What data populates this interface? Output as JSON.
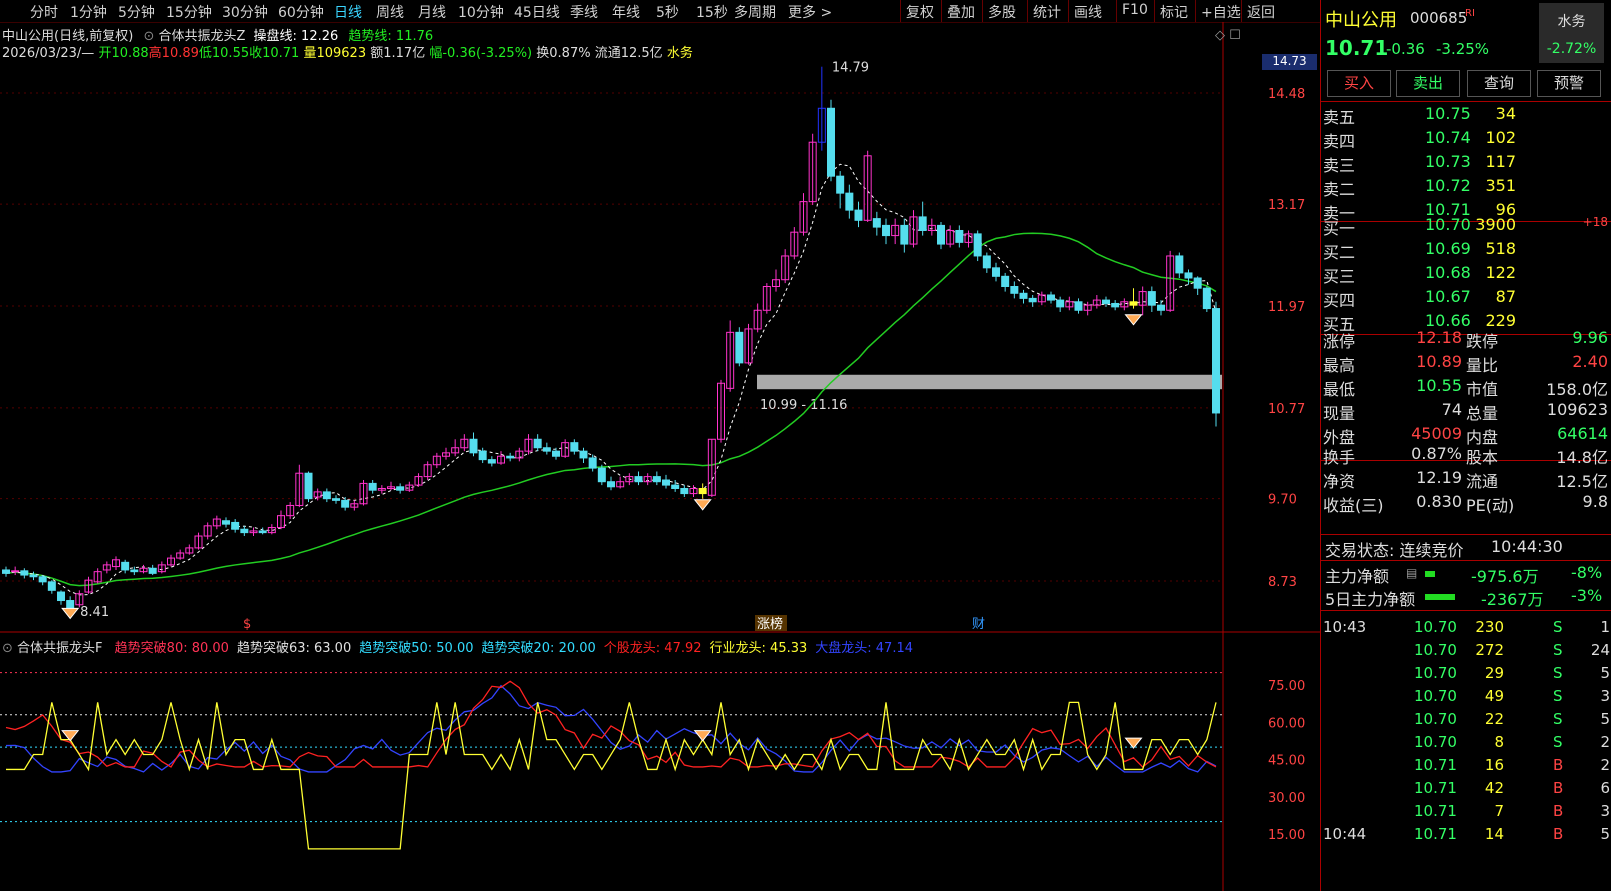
{
  "toolbar": {
    "periods": [
      "分时",
      "1分钟",
      "5分钟",
      "15分钟",
      "30分钟",
      "60分钟",
      "日线",
      "周线",
      "月线",
      "10分钟",
      "45日线",
      "季线",
      "年线",
      "5秒",
      "15秒",
      "多周期",
      "更多 >"
    ],
    "active_period": "日线",
    "right_buttons": [
      "复权",
      "叠加",
      "多股",
      "统计",
      "画线",
      "F10",
      "标记",
      "+自选",
      "返回"
    ]
  },
  "header": {
    "stock_name": "中山公用",
    "mode": "(日线,前复权)",
    "indicator_name": "合体共振龙头Z",
    "caopan_label": "操盘线: 12.26",
    "qushi_label": "趋势线: 11.76",
    "date": "2026/03/23/—",
    "open": "开10.88",
    "high": "高10.89",
    "low": "低10.55",
    "close": "收10.71",
    "volume": "量109623",
    "amount": "额1.17亿",
    "range": "幅-0.36(-3.25%)",
    "turnover": "换0.87%",
    "float": "流通12.5亿",
    "sector": "水务"
  },
  "price_axis": {
    "current": "14.73",
    "ticks": [
      "14.48",
      "13.17",
      "11.97",
      "10.77",
      "9.70",
      "8.73"
    ]
  },
  "annotations": {
    "high_label": "14.79",
    "low_label": "8.41",
    "zone_label": "10.99 - 11.16",
    "event_1": "$",
    "event_2": "涨榜",
    "event_3": "财"
  },
  "sub_indicator": {
    "name": "合体共振龙头F",
    "items": [
      {
        "text": "趋势突破80: 80.00",
        "color": "#ff3355"
      },
      {
        "text": "趋势突破63: 63.00",
        "color": "#e0e0e0"
      },
      {
        "text": "趋势突破50: 50.00",
        "color": "#33ddff"
      },
      {
        "text": "趋势突破20: 20.00",
        "color": "#33ddff"
      },
      {
        "text": "个股龙头: 47.92",
        "color": "#ff2222"
      },
      {
        "text": "行业龙头: 45.33",
        "color": "#ffff33"
      },
      {
        "text": "大盘龙头: 47.14",
        "color": "#3344ff"
      }
    ],
    "ticks": [
      "75.00",
      "60.00",
      "45.00",
      "30.00",
      "15.00"
    ]
  },
  "chart_data": {
    "type": "candlestick",
    "series": [
      {
        "name": "操盘线",
        "values": []
      },
      {
        "name": "趋势线",
        "values": []
      }
    ],
    "candles": [
      [
        8.86,
        8.82,
        8.9,
        8.78
      ],
      [
        8.84,
        8.85,
        8.9,
        8.8
      ],
      [
        8.85,
        8.8,
        8.88,
        8.76
      ],
      [
        8.8,
        8.78,
        8.84,
        8.74
      ],
      [
        8.78,
        8.72,
        8.8,
        8.68
      ],
      [
        8.72,
        8.62,
        8.74,
        8.58
      ],
      [
        8.6,
        8.5,
        8.62,
        8.45
      ],
      [
        8.5,
        8.41,
        8.55,
        8.41
      ],
      [
        8.45,
        8.58,
        8.62,
        8.42
      ],
      [
        8.6,
        8.74,
        8.78,
        8.58
      ],
      [
        8.72,
        8.84,
        8.88,
        8.7
      ],
      [
        8.86,
        8.92,
        8.96,
        8.82
      ],
      [
        8.9,
        8.98,
        9.02,
        8.86
      ],
      [
        8.95,
        8.86,
        8.98,
        8.82
      ],
      [
        8.86,
        8.84,
        8.9,
        8.8
      ],
      [
        8.84,
        8.88,
        8.92,
        8.82
      ],
      [
        8.88,
        8.82,
        8.92,
        8.8
      ],
      [
        8.84,
        8.92,
        8.96,
        8.82
      ],
      [
        8.92,
        9.0,
        9.04,
        8.9
      ],
      [
        9.0,
        9.06,
        9.1,
        8.98
      ],
      [
        9.06,
        9.12,
        9.16,
        9.04
      ],
      [
        9.12,
        9.26,
        9.3,
        9.1
      ],
      [
        9.26,
        9.38,
        9.42,
        9.22
      ],
      [
        9.38,
        9.46,
        9.5,
        9.34
      ],
      [
        9.44,
        9.4,
        9.48,
        9.36
      ],
      [
        9.42,
        9.34,
        9.46,
        9.3
      ],
      [
        9.34,
        9.3,
        9.38,
        9.26
      ],
      [
        9.3,
        9.32,
        9.36,
        9.26
      ],
      [
        9.32,
        9.3,
        9.36,
        9.28
      ],
      [
        9.3,
        9.36,
        9.4,
        9.28
      ],
      [
        9.36,
        9.5,
        9.56,
        9.34
      ],
      [
        9.5,
        9.62,
        9.66,
        9.46
      ],
      [
        9.62,
        10.0,
        10.1,
        9.6
      ],
      [
        10.0,
        9.7,
        10.02,
        9.66
      ],
      [
        9.72,
        9.78,
        9.82,
        9.68
      ],
      [
        9.78,
        9.7,
        9.82,
        9.66
      ],
      [
        9.7,
        9.68,
        9.74,
        9.64
      ],
      [
        9.68,
        9.6,
        9.72,
        9.56
      ],
      [
        9.6,
        9.64,
        9.68,
        9.56
      ],
      [
        9.64,
        9.88,
        9.92,
        9.62
      ],
      [
        9.88,
        9.8,
        9.92,
        9.76
      ],
      [
        9.8,
        9.82,
        9.86,
        9.76
      ],
      [
        9.82,
        9.84,
        9.9,
        9.8
      ],
      [
        9.84,
        9.8,
        9.88,
        9.76
      ],
      [
        9.8,
        9.86,
        9.9,
        9.78
      ],
      [
        9.86,
        9.96,
        10.0,
        9.84
      ],
      [
        9.96,
        10.1,
        10.14,
        9.92
      ],
      [
        10.1,
        10.2,
        10.24,
        10.06
      ],
      [
        10.2,
        10.24,
        10.3,
        10.16
      ],
      [
        10.24,
        10.3,
        10.4,
        10.2
      ],
      [
        10.3,
        10.4,
        10.46,
        10.26
      ],
      [
        10.4,
        10.24,
        10.48,
        10.2
      ],
      [
        10.26,
        10.16,
        10.3,
        10.12
      ],
      [
        10.16,
        10.12,
        10.2,
        10.08
      ],
      [
        10.12,
        10.2,
        10.26,
        10.1
      ],
      [
        10.2,
        10.18,
        10.24,
        10.14
      ],
      [
        10.18,
        10.26,
        10.3,
        10.14
      ],
      [
        10.26,
        10.4,
        10.46,
        10.22
      ],
      [
        10.4,
        10.3,
        10.46,
        10.26
      ],
      [
        10.3,
        10.26,
        10.36,
        10.22
      ],
      [
        10.26,
        10.2,
        10.3,
        10.16
      ],
      [
        10.2,
        10.36,
        10.4,
        10.18
      ],
      [
        10.36,
        10.26,
        10.4,
        10.22
      ],
      [
        10.26,
        10.18,
        10.3,
        10.12
      ],
      [
        10.18,
        10.06,
        10.22,
        10.02
      ],
      [
        10.06,
        9.9,
        10.1,
        9.86
      ],
      [
        9.9,
        9.84,
        9.96,
        9.8
      ],
      [
        9.84,
        9.9,
        9.96,
        9.82
      ],
      [
        9.9,
        9.96,
        10.0,
        9.86
      ],
      [
        9.96,
        9.9,
        10.02,
        9.86
      ],
      [
        9.9,
        9.96,
        10.0,
        9.86
      ],
      [
        9.96,
        9.9,
        10.02,
        9.86
      ],
      [
        9.92,
        9.86,
        9.98,
        9.82
      ],
      [
        9.86,
        9.82,
        9.92,
        9.78
      ],
      [
        9.82,
        9.76,
        9.86,
        9.72
      ],
      [
        9.76,
        9.82,
        9.86,
        9.72
      ],
      [
        9.82,
        9.76,
        9.88,
        9.7
      ],
      [
        9.74,
        10.4,
        10.4,
        9.72
      ],
      [
        10.4,
        11.06,
        11.1,
        10.36
      ],
      [
        11.0,
        11.66,
        11.8,
        10.96
      ],
      [
        11.66,
        11.3,
        11.72,
        11.26
      ],
      [
        11.3,
        11.7,
        11.76,
        11.28
      ],
      [
        11.7,
        11.92,
        12.0,
        11.66
      ],
      [
        11.92,
        12.2,
        12.24,
        11.88
      ],
      [
        12.2,
        12.28,
        12.4,
        12.14
      ],
      [
        12.28,
        12.56,
        12.64,
        12.24
      ],
      [
        12.56,
        12.84,
        12.9,
        12.52
      ],
      [
        12.84,
        13.2,
        13.3,
        12.8
      ],
      [
        13.2,
        13.9,
        14.0,
        13.16
      ],
      [
        13.9,
        14.3,
        14.79,
        13.8
      ],
      [
        14.3,
        13.5,
        14.4,
        13.44
      ],
      [
        13.5,
        13.3,
        13.56,
        13.12
      ],
      [
        13.3,
        13.1,
        13.4,
        13.0
      ],
      [
        13.1,
        12.98,
        13.2,
        12.9
      ],
      [
        12.98,
        13.74,
        13.8,
        12.96
      ],
      [
        13.0,
        12.9,
        13.08,
        12.8
      ],
      [
        12.92,
        12.8,
        13.0,
        12.7
      ],
      [
        12.8,
        12.92,
        13.0,
        12.7
      ],
      [
        12.92,
        12.7,
        13.0,
        12.6
      ],
      [
        12.7,
        13.02,
        13.1,
        12.66
      ],
      [
        13.02,
        12.86,
        13.2,
        12.8
      ],
      [
        12.86,
        12.92,
        13.0,
        12.8
      ],
      [
        12.92,
        12.7,
        12.96,
        12.64
      ],
      [
        12.7,
        12.86,
        12.92,
        12.66
      ],
      [
        12.86,
        12.72,
        12.92,
        12.66
      ],
      [
        12.72,
        12.82,
        12.86,
        12.66
      ],
      [
        12.82,
        12.56,
        12.86,
        12.5
      ],
      [
        12.56,
        12.42,
        12.6,
        12.36
      ],
      [
        12.42,
        12.32,
        12.48,
        12.26
      ],
      [
        12.32,
        12.2,
        12.36,
        12.14
      ],
      [
        12.2,
        12.12,
        12.26,
        12.06
      ],
      [
        12.12,
        12.06,
        12.16,
        12.0
      ],
      [
        12.06,
        12.02,
        12.1,
        11.96
      ],
      [
        12.02,
        12.1,
        12.14,
        11.98
      ],
      [
        12.1,
        12.04,
        12.14,
        12.0
      ],
      [
        12.04,
        11.96,
        12.08,
        11.9
      ],
      [
        11.96,
        12.02,
        12.08,
        11.92
      ],
      [
        12.02,
        11.92,
        12.06,
        11.88
      ],
      [
        11.92,
        11.98,
        12.02,
        11.86
      ],
      [
        11.98,
        12.04,
        12.1,
        11.94
      ],
      [
        12.04,
        12.0,
        12.08,
        11.96
      ],
      [
        12.0,
        11.96,
        12.04,
        11.92
      ],
      [
        11.96,
        12.02,
        12.06,
        11.92
      ],
      [
        12.02,
        11.98,
        12.18,
        11.94
      ],
      [
        11.98,
        12.14,
        12.2,
        11.86
      ],
      [
        12.14,
        11.98,
        12.2,
        11.9
      ],
      [
        11.98,
        11.92,
        12.04,
        11.86
      ],
      [
        11.92,
        12.56,
        12.62,
        11.9
      ],
      [
        12.56,
        12.36,
        12.6,
        12.3
      ],
      [
        12.36,
        12.3,
        12.4,
        12.22
      ],
      [
        12.3,
        12.18,
        12.32,
        12.1
      ],
      [
        12.18,
        11.94,
        12.2,
        11.9
      ],
      [
        11.94,
        10.71,
        12.02,
        10.55
      ]
    ],
    "xlabel": "",
    "ylabel": ""
  },
  "sidebar": {
    "name": "中山公用",
    "code": "000685",
    "tag": "RI",
    "price": "10.71",
    "change": "-0.36",
    "change_pct": "-3.25%",
    "sector_name": "水务",
    "sector_pct": "-2.72%",
    "buttons": [
      "买入",
      "卖出",
      "查询",
      "预警"
    ],
    "asks": [
      {
        "label": "卖五",
        "price": "10.75",
        "vol": "34"
      },
      {
        "label": "卖四",
        "price": "10.74",
        "vol": "102"
      },
      {
        "label": "卖三",
        "price": "10.73",
        "vol": "117"
      },
      {
        "label": "卖二",
        "price": "10.72",
        "vol": "351"
      },
      {
        "label": "卖一",
        "price": "10.71",
        "vol": "96"
      }
    ],
    "bids": [
      {
        "label": "买一",
        "price": "10.70",
        "vol": "3900",
        "extra": "+18"
      },
      {
        "label": "买二",
        "price": "10.69",
        "vol": "518",
        "extra": ""
      },
      {
        "label": "买三",
        "price": "10.68",
        "vol": "122",
        "extra": ""
      },
      {
        "label": "买四",
        "price": "10.67",
        "vol": "87",
        "extra": ""
      },
      {
        "label": "买五",
        "price": "10.66",
        "vol": "229",
        "extra": ""
      }
    ],
    "stats1": [
      {
        "l1": "涨停",
        "v1": "12.18",
        "l2": "跌停",
        "v2": "9.96"
      },
      {
        "l1": "最高",
        "v1": "10.89",
        "l2": "量比",
        "v2": "2.40"
      },
      {
        "l1": "最低",
        "v1": "10.55",
        "l2": "市值",
        "v2": "158.0亿"
      },
      {
        "l1": "现量",
        "v1": "74",
        "l2": "总量",
        "v2": "109623"
      },
      {
        "l1": "外盘",
        "v1": "45009",
        "l2": "内盘",
        "v2": "64614"
      }
    ],
    "stats2": [
      {
        "l1": "换手",
        "v1": "0.87%",
        "l2": "股本",
        "v2": "14.8亿"
      },
      {
        "l1": "净资",
        "v1": "12.19",
        "l2": "流通",
        "v2": "12.5亿"
      },
      {
        "l1": "收益(三)",
        "v1": "0.830",
        "l2": "PE(动)",
        "v2": "9.8"
      }
    ],
    "trade_state_label": "交易状态: 连续竞价",
    "trade_time": "10:44:30",
    "main_net_label": "主力净额",
    "main_net_val": "-975.6万",
    "main_net_pct": "-8%",
    "main5_label": "5日主力净额",
    "main5_val": "-2367万",
    "main5_pct": "-3%",
    "ticks": [
      {
        "t": "10:43",
        "p": "10.70",
        "v": "230",
        "s": "S",
        "n": "1"
      },
      {
        "t": "",
        "p": "10.70",
        "v": "272",
        "s": "S",
        "n": "24"
      },
      {
        "t": "",
        "p": "10.70",
        "v": "29",
        "s": "S",
        "n": "5"
      },
      {
        "t": "",
        "p": "10.70",
        "v": "49",
        "s": "S",
        "n": "3"
      },
      {
        "t": "",
        "p": "10.70",
        "v": "22",
        "s": "S",
        "n": "5"
      },
      {
        "t": "",
        "p": "10.70",
        "v": "8",
        "s": "S",
        "n": "2"
      },
      {
        "t": "",
        "p": "10.71",
        "v": "16",
        "s": "B",
        "n": "2"
      },
      {
        "t": "",
        "p": "10.71",
        "v": "42",
        "s": "B",
        "n": "6"
      },
      {
        "t": "",
        "p": "10.71",
        "v": "7",
        "s": "B",
        "n": "3"
      },
      {
        "t": "10:44",
        "p": "10.71",
        "v": "14",
        "s": "B",
        "n": "5"
      }
    ]
  },
  "colors": {
    "up": "#ff33cc",
    "down": "#55ddee",
    "ma": "#22cc22",
    "accent_red": "#ff3333",
    "accent_green": "#33ff33",
    "yellow": "#ffff33"
  }
}
